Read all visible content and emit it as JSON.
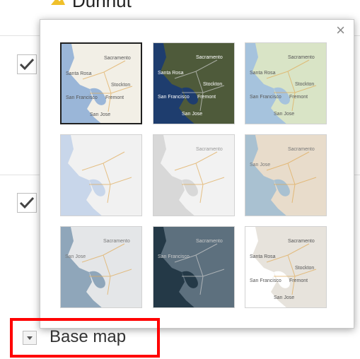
{
  "header": {
    "partial_title": "Dunnut"
  },
  "panel": {
    "close_symbol": "×"
  },
  "layers": [
    {
      "checked": true,
      "check_symbol": "✓"
    },
    {
      "checked": true,
      "check_symbol": "✓"
    }
  ],
  "basemap": {
    "label": "Base map",
    "selected_index": 0,
    "thumbnails": [
      {
        "id": "streets",
        "labels": [
          "Sacramento",
          "Santa Rosa",
          "San Francisco",
          "Stockton",
          "Fremont",
          "San Jose"
        ]
      },
      {
        "id": "satellite",
        "labels": [
          "Sacramento",
          "Santa Rosa",
          "San Francisco",
          "Stockton",
          "Fremont",
          "San Jose"
        ]
      },
      {
        "id": "terrain",
        "labels": [
          "Sacramento",
          "Santa Rosa",
          "San Francisco",
          "Stockton",
          "Fremont",
          "San Jose"
        ]
      },
      {
        "id": "light-blue",
        "labels": []
      },
      {
        "id": "light-gray",
        "labels": [
          "Sacramento"
        ]
      },
      {
        "id": "beige",
        "labels": [
          "Sacramento",
          "San Jose"
        ]
      },
      {
        "id": "gray-blue",
        "labels": [
          "Sacramento",
          "San Jose"
        ]
      },
      {
        "id": "dark",
        "labels": [
          "Sacramento",
          "San Francisco"
        ]
      },
      {
        "id": "white",
        "labels": [
          "Sacramento",
          "Santa Rosa",
          "San Francisco",
          "Stockton",
          "Fremont",
          "San Jose"
        ]
      }
    ]
  },
  "colors": {
    "highlight": "#ff0000",
    "streets_sea": "#9ab6d8",
    "streets_land": "#f2efe6",
    "satellite_sea": "#1e3d6e",
    "satellite_land": "#4e5a3a",
    "terrain_sea": "#a6c3dd",
    "terrain_land": "#d9e4c6",
    "lightblue_sea": "#c8d6ea",
    "lightblue_land": "#f1f1f1",
    "lightgray_sea": "#d8d8d8",
    "lightgray_land": "#f2f2f2",
    "beige_sea": "#a9c1d1",
    "beige_land": "#e8dccb",
    "grayblue_sea": "#8fa6ba",
    "grayblue_land": "#e4e6e8",
    "dark_sea": "#243947",
    "dark_land": "#5d707e",
    "white_sea": "#ffffff",
    "white_land": "#e7e3dc"
  }
}
